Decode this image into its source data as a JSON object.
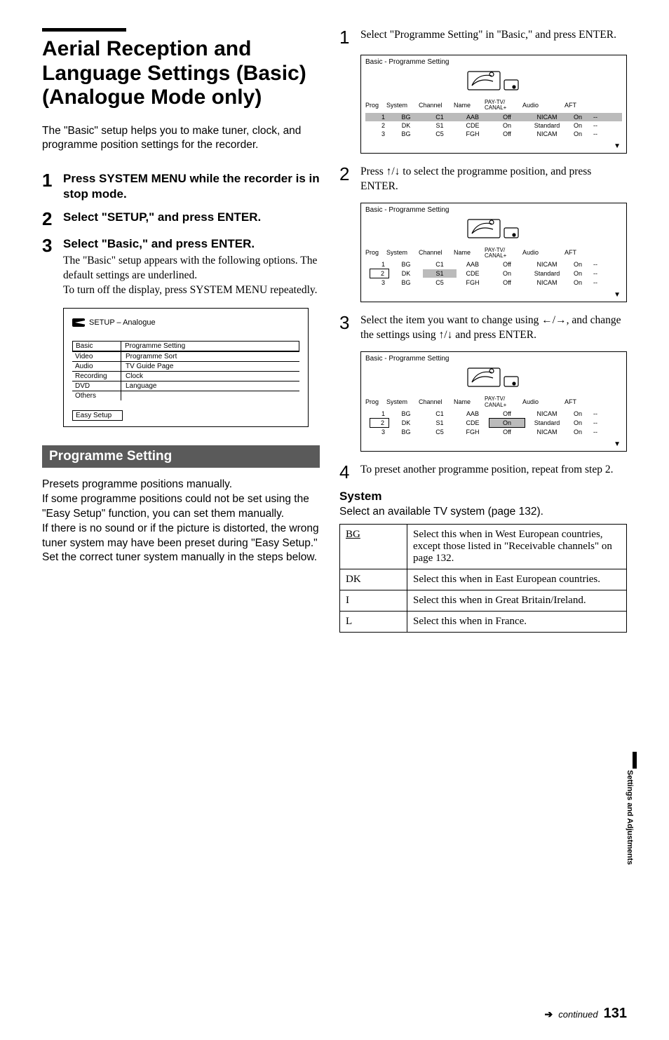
{
  "left": {
    "title": "Aerial Reception and Language Settings (Basic)\n(Analogue Mode only)",
    "intro": "The \"Basic\" setup helps you to make tuner, clock, and programme position settings for the recorder.",
    "steps": [
      {
        "n": "1",
        "bold": "Press SYSTEM MENU while the recorder is in stop mode."
      },
      {
        "n": "2",
        "bold": "Select \"SETUP,\" and press ENTER."
      },
      {
        "n": "3",
        "bold": "Select \"Basic,\" and press ENTER.",
        "sub": "The \"Basic\" setup appears with the following options. The default settings are underlined.\nTo turn off the display, press SYSTEM MENU repeatedly."
      }
    ],
    "setup": {
      "title": "SETUP – Analogue",
      "rows": [
        [
          "Basic",
          "Programme Setting"
        ],
        [
          "Video",
          "Programme Sort"
        ],
        [
          "Audio",
          "TV Guide Page"
        ],
        [
          "Recording",
          "Clock"
        ],
        [
          "DVD",
          "Language"
        ],
        [
          "Others",
          ""
        ]
      ],
      "easy": "Easy Setup"
    },
    "section": "Programme Setting",
    "para1": "Presets programme positions manually.\nIf some programme positions could not be set using the \"Easy Setup\" function, you can set them manually.\nIf there is no sound or if the picture is distorted, the wrong tuner system may have been preset during \"Easy Setup.\" Set the correct tuner system manually in the steps below."
  },
  "right": {
    "steps": [
      {
        "n": "1",
        "text": "Select \"Programme Setting\" in \"Basic,\" and press ENTER."
      },
      {
        "n": "2",
        "text": "Press ↑/↓ to select the programme position, and press ENTER."
      },
      {
        "n": "3",
        "text": "Select the item you want to change using ←/→, and change the settings using ↑/↓ and press ENTER."
      },
      {
        "n": "4",
        "text": "To preset another programme position, repeat from step 2."
      }
    ],
    "panel_title": "Basic - Programme Setting",
    "panel_head": [
      "Prog",
      "System",
      "Channel",
      "Name",
      "PAY-TV/\nCANAL+",
      "Audio",
      "AFT",
      ""
    ],
    "panel_rows": [
      [
        "1",
        "BG",
        "C1",
        "AAB",
        "Off",
        "NICAM",
        "On",
        "--"
      ],
      [
        "2",
        "DK",
        "S1",
        "CDE",
        "On",
        "Standard",
        "On",
        "--"
      ],
      [
        "3",
        "BG",
        "C5",
        "FGH",
        "Off",
        "NICAM",
        "On",
        "--"
      ]
    ],
    "sys_head": "System",
    "sys_sub": "Select an available TV system (page 132).",
    "sys_rows": [
      [
        "BG",
        "Select this when in West European countries, except those listed in \"Receivable channels\" on page 132."
      ],
      [
        "DK",
        "Select this when in East European countries."
      ],
      [
        "I",
        "Select this when in Great Britain/Ireland."
      ],
      [
        "L",
        "Select this when in France."
      ]
    ]
  },
  "side": "Settings and Adjustments",
  "footer": {
    "cont": "continued",
    "page": "131"
  }
}
